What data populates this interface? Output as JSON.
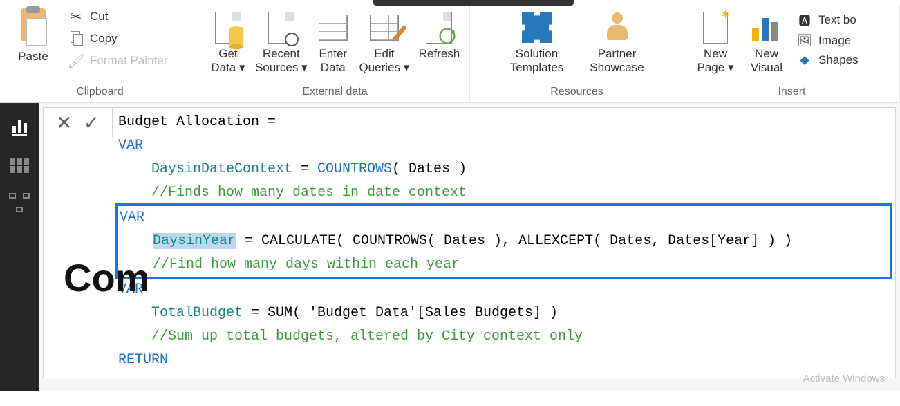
{
  "ribbon": {
    "clipboard": {
      "group_label": "Clipboard",
      "paste": "Paste",
      "cut": "Cut",
      "copy": "Copy",
      "format_painter": "Format Painter"
    },
    "external_data": {
      "group_label": "External data",
      "get_data": "Get\nData ▾",
      "recent_sources": "Recent\nSources ▾",
      "enter_data": "Enter\nData",
      "edit_queries": "Edit\nQueries ▾",
      "refresh": "Refresh"
    },
    "resources": {
      "group_label": "Resources",
      "solution_templates": "Solution\nTemplates",
      "partner_showcase": "Partner\nShowcase"
    },
    "insert": {
      "group_label": "Insert",
      "new_page": "New\nPage ▾",
      "new_visual": "New\nVisual",
      "text_box": "Text bo",
      "image": "Image",
      "shapes": "Shapes"
    }
  },
  "formula_bar": {
    "cancel_glyph": "✕",
    "commit_glyph": "✓"
  },
  "dax": {
    "line1_name": "Budget Allocation =",
    "var_kw": "VAR",
    "return_kw": "RETURN",
    "v1_name": "DaysinDateContext",
    "v1_eq": " = ",
    "v1_fn": "COUNTROWS",
    "v1_args": "( Dates )",
    "c1": "//Finds how many dates in date context",
    "v2_name": "DaysinYear",
    "v2_rest": " = CALCULATE( COUNTROWS( Dates ), ALLEXCEPT( Dates, Dates[Year] ) )",
    "c2": "//Find how many days within each year",
    "v3_name": "TotalBudget",
    "v3_rest": " = SUM( 'Budget Data'[Sales Budgets] )",
    "c3": "//Sum up total budgets, altered by City context only"
  },
  "canvas": {
    "title_fragment": "Com"
  },
  "watermark": "Activate Windows"
}
